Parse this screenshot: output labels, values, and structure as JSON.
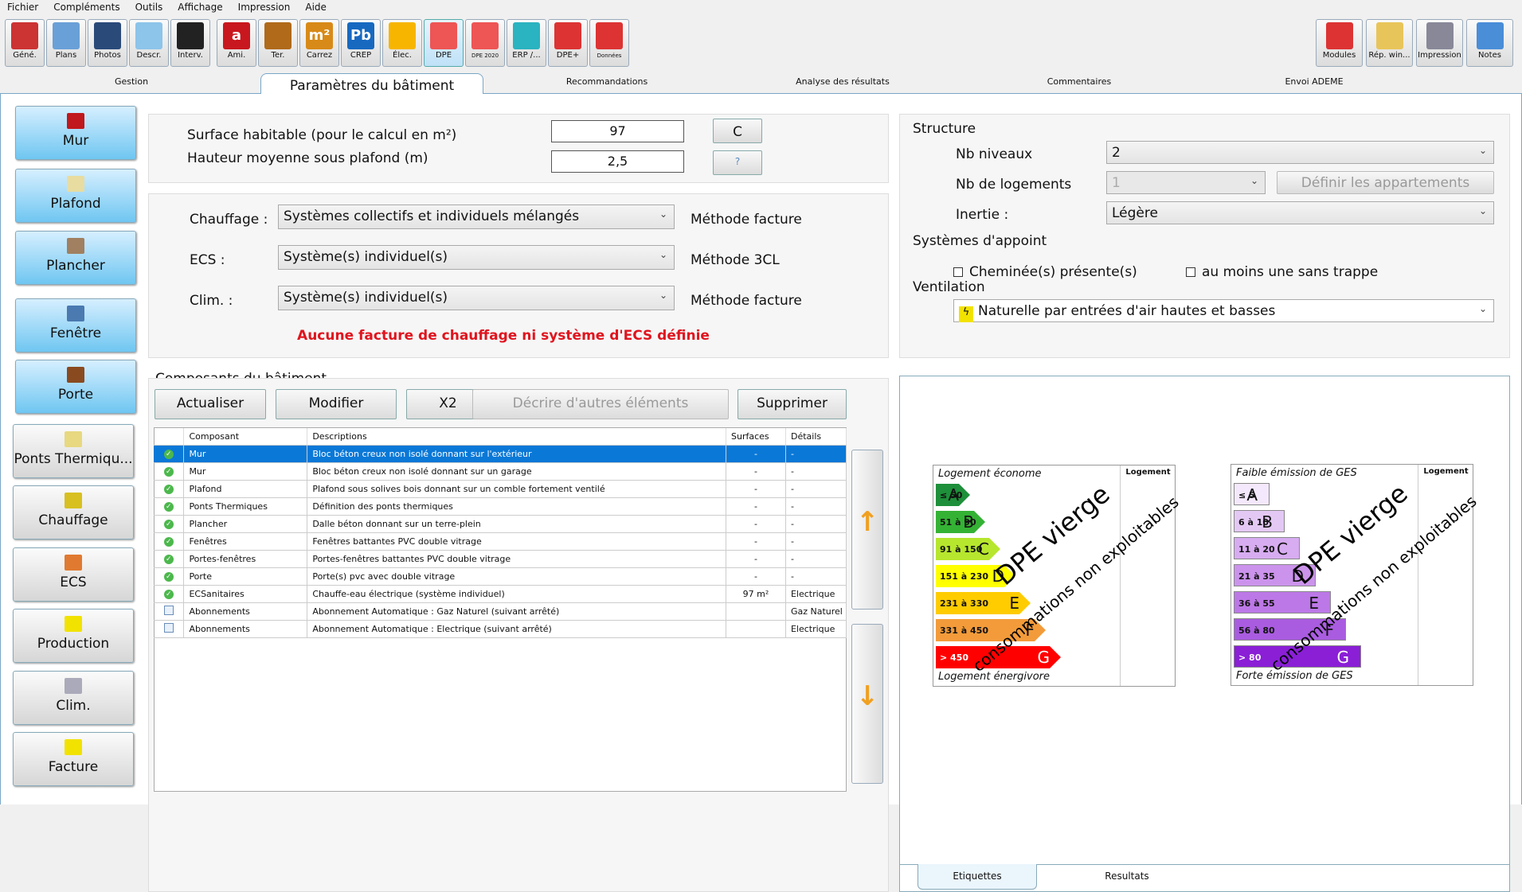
{
  "menu": [
    "Fichier",
    "Compléments",
    "Outils",
    "Affichage",
    "Impression",
    "Aide"
  ],
  "toolbar": [
    {
      "label": "Géné.",
      "icon": "house-icon",
      "color": "#c33"
    },
    {
      "label": "Plans",
      "icon": "plans-icon",
      "color": "#6aa0d8"
    },
    {
      "label": "Photos",
      "icon": "camera-icon",
      "color": "#2a4a7a"
    },
    {
      "label": "Descr.",
      "icon": "description-icon",
      "color": "#8cc4ea"
    },
    {
      "label": "Interv.",
      "icon": "phone-icon",
      "color": "#222"
    },
    {
      "label": "Ami.",
      "icon": "amiante-icon",
      "color": "#c8171e",
      "glyph": "a"
    },
    {
      "label": "Ter.",
      "icon": "termite-icon",
      "color": "#b06a1a"
    },
    {
      "label": "Carrez",
      "icon": "m2-icon",
      "color": "#d88a18",
      "glyph": "m²"
    },
    {
      "label": "CREP",
      "icon": "lead-icon",
      "color": "#1769c0",
      "glyph": "Pb"
    },
    {
      "label": "Élec.",
      "icon": "plug-icon",
      "color": "#f7b500"
    },
    {
      "label": "DPE",
      "icon": "dpe-icon",
      "color": "#e55"
    },
    {
      "label": "DPE 2020",
      "icon": "dpe2020-icon",
      "color": "#e55"
    },
    {
      "label": "ERP /...",
      "icon": "factory-icon",
      "color": "#2ab3c0"
    },
    {
      "label": "DPE+",
      "icon": "dpe-plus-icon",
      "color": "#d33"
    },
    {
      "label": "Données",
      "icon": "data-icon",
      "color": "#d33"
    }
  ],
  "toolbar_right": [
    {
      "label": "Modules",
      "icon": "puzzle-icon",
      "color": "#d33"
    },
    {
      "label": "Rép. win...",
      "icon": "folder-icon",
      "color": "#e8c55a"
    },
    {
      "label": "Impression",
      "icon": "printer-icon",
      "color": "#889"
    },
    {
      "label": "Notes",
      "icon": "notes-icon",
      "color": "#4a8ed8"
    }
  ],
  "tabs": [
    "Gestion",
    "Paramètres du bâtiment",
    "Recommandations",
    "Analyse des résultats",
    "Commentaires",
    "Envoi ADEME"
  ],
  "sidebar": [
    {
      "label": "Mur",
      "color": "#c0181c"
    },
    {
      "label": "Plafond",
      "color": "#e8dca0"
    },
    {
      "label": "Plancher",
      "color": "#a08060"
    },
    {
      "label": "Fenêtre",
      "color": "#4a7ab0"
    },
    {
      "label": "Porte",
      "color": "#8a4a20"
    },
    {
      "label": "Ponts  Thermiqu...",
      "color": "#e8d880"
    },
    {
      "label": "Chauffage",
      "color": "#d8c020"
    },
    {
      "label": "ECS",
      "color": "#e07a30"
    },
    {
      "label": "Production",
      "color": "#f2e200"
    },
    {
      "label": "Clim.",
      "color": "#aab"
    },
    {
      "label": "Facture",
      "color": "#f2e200"
    }
  ],
  "surface": {
    "label": "Surface habitable (pour le calcul en m²)",
    "value": "97",
    "btn": "C"
  },
  "hauteur": {
    "label": "Hauteur moyenne sous plafond (m)",
    "value": "2,5",
    "btn": "?"
  },
  "systems": [
    {
      "label": "Chauffage :",
      "value": "Systèmes collectifs et individuels mélangés",
      "method": "Méthode facture"
    },
    {
      "label": "ECS :",
      "value": "Système(s) individuel(s)",
      "method": "Méthode 3CL"
    },
    {
      "label": "Clim. :",
      "value": "Système(s) individuel(s)",
      "method": "Méthode facture"
    }
  ],
  "warning": "Aucune facture de chauffage ni système d'ECS définie",
  "composants": {
    "title": "Composants du bâtiment",
    "buttons": [
      "Actualiser",
      "Modifier",
      "X2",
      "Décrire d'autres éléments",
      "Supprimer"
    ],
    "columns": [
      "",
      "Composant",
      "Descriptions",
      "Surfaces",
      "Détails"
    ],
    "rows": [
      {
        "status": "ok",
        "composant": "Mur",
        "description": "Bloc béton creux non isolé donnant sur l'extérieur",
        "surface": "-",
        "details": "-"
      },
      {
        "status": "ok",
        "composant": "Mur",
        "description": "Bloc béton creux non isolé donnant sur un garage",
        "surface": "-",
        "details": "-"
      },
      {
        "status": "ok",
        "composant": "Plafond",
        "description": "Plafond sous solives bois donnant sur un comble fortement ventilé",
        "surface": "-",
        "details": "-"
      },
      {
        "status": "ok",
        "composant": "Ponts Thermiques",
        "description": "Définition des ponts thermiques",
        "surface": "-",
        "details": "-"
      },
      {
        "status": "ok",
        "composant": "Plancher",
        "description": "Dalle béton donnant sur un terre-plein",
        "surface": "-",
        "details": "-"
      },
      {
        "status": "ok",
        "composant": "Fenêtres",
        "description": "Fenêtres battantes PVC double vitrage",
        "surface": "-",
        "details": "-"
      },
      {
        "status": "ok",
        "composant": "Portes-fenêtres",
        "description": "Portes-fenêtres battantes PVC double vitrage",
        "surface": "-",
        "details": "-"
      },
      {
        "status": "ok",
        "composant": "Porte",
        "description": "Porte(s) pvc avec double vitrage",
        "surface": "-",
        "details": "-"
      },
      {
        "status": "ok",
        "composant": "ECSanitaires",
        "description": "Chauffe-eau électrique (système individuel)",
        "surface": "97 m²",
        "details": "Electrique"
      },
      {
        "status": "doc",
        "composant": "Abonnements",
        "description": "Abonnement  Automatique : Gaz Naturel (suivant arrêté)",
        "surface": "",
        "details": "Gaz Naturel"
      },
      {
        "status": "doc",
        "composant": "Abonnements",
        "description": "Abonnement  Automatique : Electrique (suivant arrêté)",
        "surface": "",
        "details": "Electrique"
      }
    ],
    "selected_row": 0
  },
  "structure": {
    "title": "Structure",
    "nb_niveaux": {
      "label": "Nb niveaux",
      "value": "2"
    },
    "nb_logements": {
      "label": "Nb de logements",
      "value": "1",
      "btn": "Définir les appartements"
    },
    "inertie": {
      "label": "Inertie :",
      "value": "Légère"
    },
    "appoint_title": "Systèmes d'appoint",
    "cheminee": {
      "label": "Cheminée(s) présente(s)",
      "checked": false
    },
    "sans_trappe": {
      "label": "au moins une sans trappe",
      "checked": false
    },
    "ventilation_title": "Ventilation",
    "ventilation": "Naturelle par entrées d'air hautes et basses"
  },
  "labels": {
    "tabs": [
      "Etiquettes",
      "Resultats"
    ],
    "energy": {
      "top": "Logement économe",
      "bottom": "Logement énergivore",
      "col": "Logement",
      "classes": [
        {
          "range": "≤ 50",
          "letter": "A",
          "color": "#1e8f3a"
        },
        {
          "range": "51 à 90",
          "letter": "B",
          "color": "#34b234"
        },
        {
          "range": "91 à 150",
          "letter": "C",
          "color": "#b7e62e"
        },
        {
          "range": "151 à 230",
          "letter": "D",
          "color": "#ffff00"
        },
        {
          "range": "231 à 330",
          "letter": "E",
          "color": "#ffcc00"
        },
        {
          "range": "331 à 450",
          "letter": "F",
          "color": "#f39b3a"
        },
        {
          "range": "> 450",
          "letter": "G",
          "color": "#ff0000"
        }
      ]
    },
    "ges": {
      "top": "Faible émission de GES",
      "bottom": "Forte émission de GES",
      "col": "Logement",
      "classes": [
        {
          "range": "≤ 5",
          "letter": "A",
          "color": "#f4e8fc"
        },
        {
          "range": "6 à 10",
          "letter": "B",
          "color": "#e3c8f4"
        },
        {
          "range": "11 à 20",
          "letter": "C",
          "color": "#d7acf0"
        },
        {
          "range": "21 à 35",
          "letter": "D",
          "color": "#cb93ec"
        },
        {
          "range": "36 à 55",
          "letter": "E",
          "color": "#bc78e7"
        },
        {
          "range": "56 à 80",
          "letter": "F",
          "color": "#a95ce0"
        },
        {
          "range": "> 80",
          "letter": "G",
          "color": "#8a1fd6"
        }
      ]
    },
    "watermark1": "DPE vierge",
    "watermark2": "consommations non exploitables"
  }
}
